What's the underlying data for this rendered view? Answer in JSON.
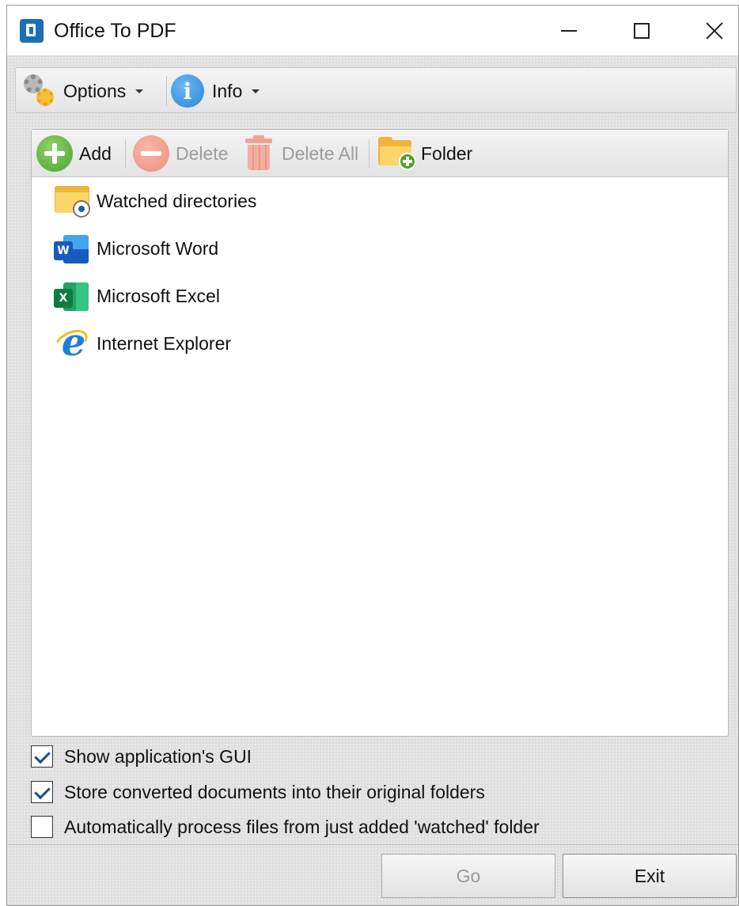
{
  "window": {
    "title": "Office To PDF"
  },
  "main_toolbar": {
    "options_label": "Options",
    "info_label": "Info"
  },
  "list_toolbar": {
    "add_label": "Add",
    "delete_label": "Delete",
    "delete_all_label": "Delete All",
    "folder_label": "Folder"
  },
  "list": {
    "items": [
      {
        "label": "Watched directories",
        "icon": "watched-folder-icon"
      },
      {
        "label": "Microsoft Word",
        "icon": "word-icon"
      },
      {
        "label": "Microsoft Excel",
        "icon": "excel-icon"
      },
      {
        "label": "Internet Explorer",
        "icon": "internet-explorer-icon"
      }
    ]
  },
  "options": {
    "show_gui": {
      "label": "Show application's GUI",
      "checked": true
    },
    "store_original": {
      "label": "Store converted documents into their original folders",
      "checked": true
    },
    "auto_process": {
      "label": "Automatically process files from just added 'watched' folder",
      "checked": false
    }
  },
  "buttons": {
    "go_label": "Go",
    "exit_label": "Exit"
  },
  "icon_glyphs": {
    "word_tag": "W",
    "excel_tag": "X",
    "ie_glyph": "e",
    "info_glyph": "i"
  },
  "colors": {
    "accent": "#1b6fb4",
    "add_green": "#4ba32d",
    "disabled_text": "#9c9c9c"
  }
}
